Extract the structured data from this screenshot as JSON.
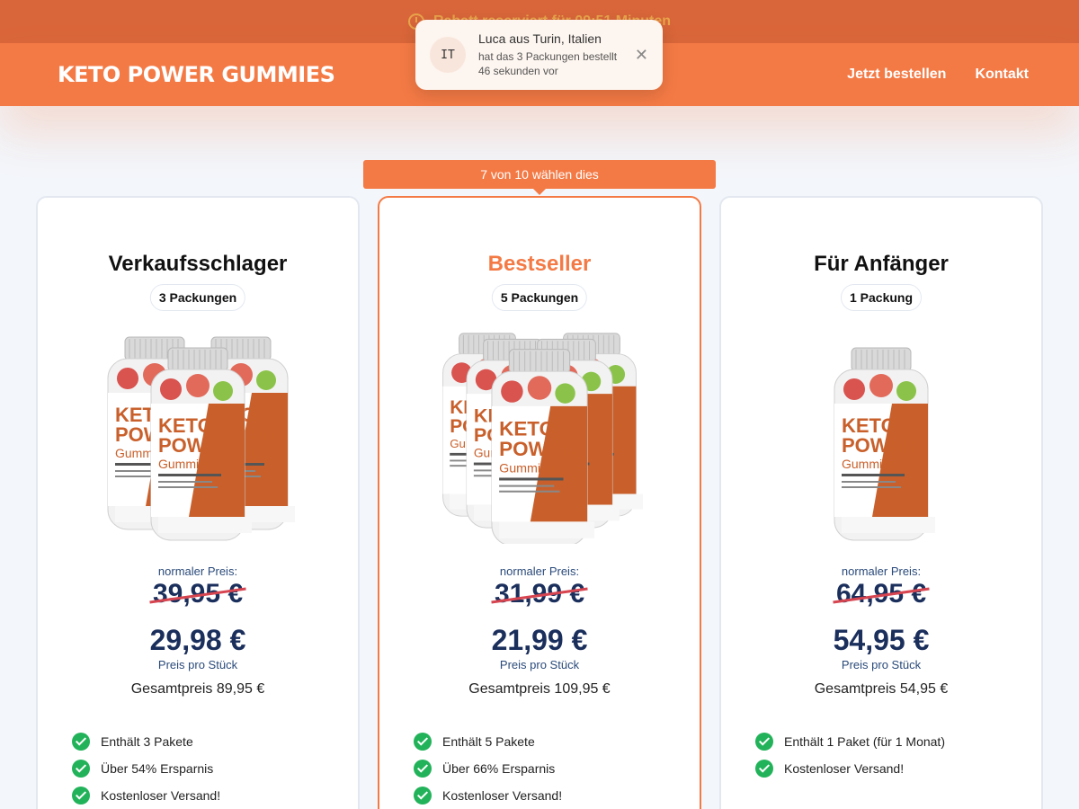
{
  "promo": {
    "text": "Rabatt reserviert für 09:51 Minuten"
  },
  "header": {
    "logo": "KETO POWER GUMMIES",
    "nav": [
      {
        "label": "Jetzt bestellen"
      },
      {
        "label": "Kontakt"
      }
    ]
  },
  "toast": {
    "flag": "IT",
    "name": "Luca aus Turin, Italien",
    "message": "hat das 3 Packungen bestellt",
    "time": "46 sekunden vor"
  },
  "ribbon": "7 von 10 wählen dies",
  "cards": [
    {
      "title": "Verkaufsschlager",
      "pill": "3 Packungen",
      "regular_label": "normaler Preis:",
      "old_price": "39,95 €",
      "price": "29,98 €",
      "unit_label": "Preis pro Stück",
      "total": "Gesamtpreis 89,95 €",
      "features": [
        "Enthält 3 Pakete",
        "Über 54% Ersparnis",
        "Kostenloser Versand!"
      ],
      "bottles": 3
    },
    {
      "title": "Bestseller",
      "pill": "5 Packungen",
      "regular_label": "normaler Preis:",
      "old_price": "31,99 €",
      "price": "21,99 €",
      "unit_label": "Preis pro Stück",
      "total": "Gesamtpreis 109,95 €",
      "features": [
        "Enthält 5 Pakete",
        "Über 66% Ersparnis",
        "Kostenloser Versand!"
      ],
      "bottles": 5
    },
    {
      "title": "Für Anfänger",
      "pill": "1 Packung",
      "regular_label": "normaler Preis:",
      "old_price": "64,95 €",
      "price": "54,95 €",
      "unit_label": "Preis pro Stück",
      "total": "Gesamtpreis 54,95 €",
      "features": [
        "Enthält 1 Paket (für 1 Monat)",
        "Kostenloser Versand!"
      ],
      "bottles": 1
    }
  ],
  "bottle_label": {
    "line1": "KETO",
    "line2": "POWER",
    "line3": "Gummies"
  },
  "colors": {
    "accent": "#f47a45",
    "price": "#1b2f5c",
    "check": "#22b35a",
    "strike": "#d64550"
  }
}
